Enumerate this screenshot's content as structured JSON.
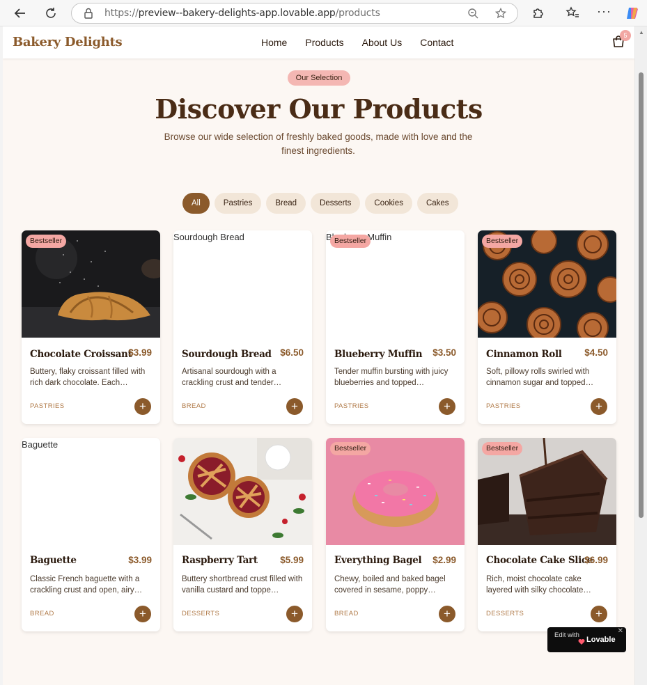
{
  "browser": {
    "url_prefix": "https://",
    "url_host": "preview--bakery-delights-app.lovable.app",
    "url_path": "/products"
  },
  "header": {
    "logo": "Bakery Delights",
    "nav": [
      "Home",
      "Products",
      "About Us",
      "Contact"
    ],
    "cart_count": "5"
  },
  "hero": {
    "eyebrow": "Our Selection",
    "title": "Discover Our Products",
    "subtitle": "Browse our wide selection of freshly baked goods, made with love and the finest ingredients."
  },
  "filters": [
    "All",
    "Pastries",
    "Bread",
    "Desserts",
    "Cookies",
    "Cakes"
  ],
  "active_filter": "All",
  "products": [
    {
      "name": "Chocolate Croissant",
      "price": "$3.99",
      "desc": "Buttery, flaky croissant filled with rich dark chocolate. Each…",
      "category": "PASTRIES",
      "badge": "Bestseller",
      "image": "croissant",
      "alt": ""
    },
    {
      "name": "Sourdough Bread",
      "price": "$6.50",
      "desc": "Artisanal sourdough with a crackling crust and tender…",
      "category": "BREAD",
      "badge": "",
      "image": "broken",
      "alt": "Sourdough Bread"
    },
    {
      "name": "Blueberry Muffin",
      "price": "$3.50",
      "desc": "Tender muffin bursting with juicy blueberries and topped…",
      "category": "PASTRIES",
      "badge": "Bestseller",
      "image": "broken",
      "alt": "Blueberry Muffin"
    },
    {
      "name": "Cinnamon Roll",
      "price": "$4.50",
      "desc": "Soft, pillowy rolls swirled with cinnamon sugar and topped…",
      "category": "PASTRIES",
      "badge": "Bestseller",
      "image": "cinnamon",
      "alt": ""
    },
    {
      "name": "Baguette",
      "price": "$3.99",
      "desc": "Classic French baguette with a crackling crust and open, airy…",
      "category": "BREAD",
      "badge": "",
      "image": "broken",
      "alt": "Baguette"
    },
    {
      "name": "Raspberry Tart",
      "price": "$5.99",
      "desc": "Buttery shortbread crust filled with vanilla custard and toppe…",
      "category": "DESSERTS",
      "badge": "",
      "image": "tart",
      "alt": ""
    },
    {
      "name": "Everything Bagel",
      "price": "$2.99",
      "desc": "Chewy, boiled and baked bagel covered in sesame, poppy…",
      "category": "BREAD",
      "badge": "Bestseller",
      "image": "donut",
      "alt": ""
    },
    {
      "name": "Chocolate Cake Slice",
      "price": "$6.99",
      "desc": "Rich, moist chocolate cake layered with silky chocolate…",
      "category": "DESSERTS",
      "badge": "Bestseller",
      "image": "cake",
      "alt": ""
    }
  ],
  "widget": {
    "edit_label": "Edit with",
    "brand": "Lovable"
  },
  "colors": {
    "accent": "#8b5a2b",
    "badge": "#f4a7a3",
    "background": "#fcf7f3"
  }
}
